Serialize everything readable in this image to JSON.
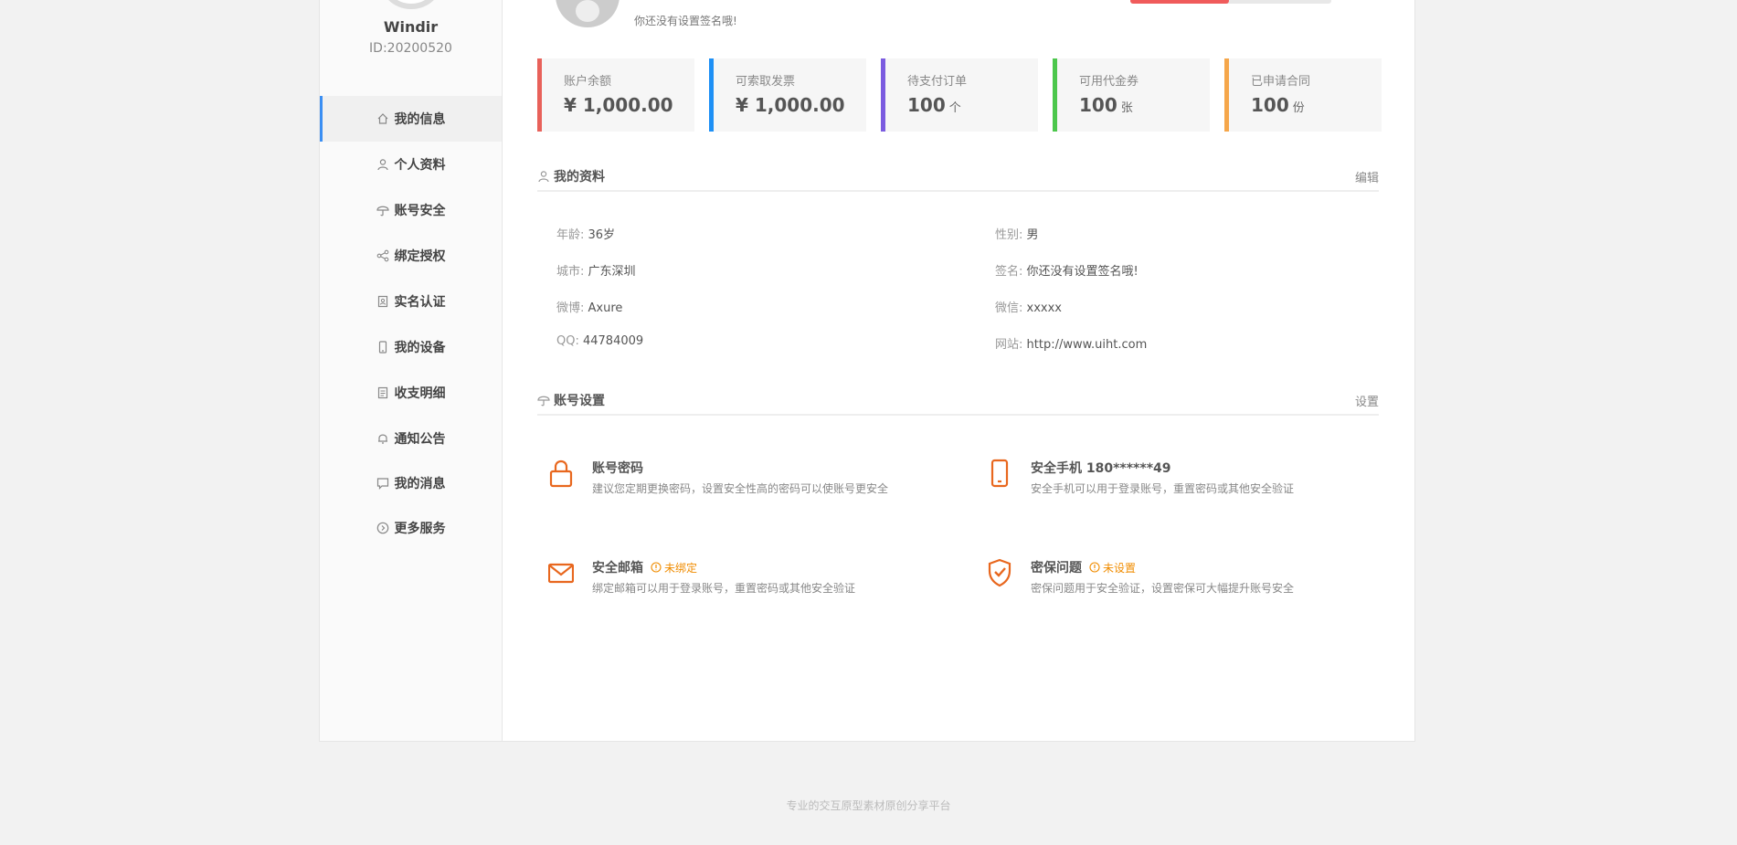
{
  "user": {
    "name": "Windir",
    "id": "ID:20200520",
    "signature": "你还没有设置签名哦!"
  },
  "sidebar": {
    "items": [
      {
        "label": "我的信息",
        "icon": "home-icon"
      },
      {
        "label": "个人资料",
        "icon": "user-icon"
      },
      {
        "label": "账号安全",
        "icon": "umbrella-icon"
      },
      {
        "label": "绑定授权",
        "icon": "share-icon"
      },
      {
        "label": "实名认证",
        "icon": "id-card-icon"
      },
      {
        "label": "我的设备",
        "icon": "phone-icon"
      },
      {
        "label": "收支明细",
        "icon": "document-icon"
      },
      {
        "label": "通知公告",
        "icon": "bell-icon"
      },
      {
        "label": "我的消息",
        "icon": "chat-icon"
      },
      {
        "label": "更多服务",
        "icon": "arrow-circle-icon"
      }
    ]
  },
  "progress": {
    "fraction": 0.49
  },
  "stats": [
    {
      "label": "账户余额",
      "value": "¥ 1,000.00",
      "unit": "",
      "color": "#e8615a"
    },
    {
      "label": "可索取发票",
      "value": "¥ 1,000.00",
      "unit": "",
      "color": "#1e90f5"
    },
    {
      "label": "待支付订单",
      "value": "100",
      "unit": "个",
      "color": "#7b5ce0"
    },
    {
      "label": "可用代金券",
      "value": "100",
      "unit": "张",
      "color": "#4cc74c"
    },
    {
      "label": "已申请合同",
      "value": "100",
      "unit": "份",
      "color": "#f5a64a"
    }
  ],
  "profile": {
    "title": "我的资料",
    "edit": "编辑",
    "fields": [
      {
        "k": "年龄: ",
        "v": "36岁"
      },
      {
        "k": "性别: ",
        "v": "男"
      },
      {
        "k": "城市: ",
        "v": "广东深圳"
      },
      {
        "k": "签名: ",
        "v": "你还没有设置签名哦!"
      },
      {
        "k": "微博: ",
        "v": "Axure"
      },
      {
        "k": "微信: ",
        "v": "xxxxx"
      },
      {
        "k": "QQ: ",
        "v": "44784009"
      },
      {
        "k": "网站: ",
        "v": "http://www.uiht.com"
      }
    ]
  },
  "account": {
    "title": "账号设置",
    "settings": "设置",
    "items": [
      {
        "title": "账号密码",
        "badge": "",
        "desc": "建议您定期更换密码，设置安全性高的密码可以使账号更安全",
        "icon": "lock-icon"
      },
      {
        "title": "安全手机 180******49",
        "badge": "",
        "desc": "安全手机可以用于登录账号，重置密码或其他安全验证",
        "icon": "mobile-icon"
      },
      {
        "title": "安全邮箱",
        "badge": "未绑定",
        "desc": "绑定邮箱可以用于登录账号，重置密码或其他安全验证",
        "icon": "mail-icon"
      },
      {
        "title": "密保问题",
        "badge": "未设置",
        "desc": "密保问题用于安全验证，设置密保可大幅提升账号安全",
        "icon": "shield-check-icon"
      }
    ]
  },
  "footer": "专业的交互原型素材原创分享平台",
  "colors": {
    "accent": "#3b8ff3",
    "orange": "#e8671e",
    "badge": "#f08c00"
  }
}
